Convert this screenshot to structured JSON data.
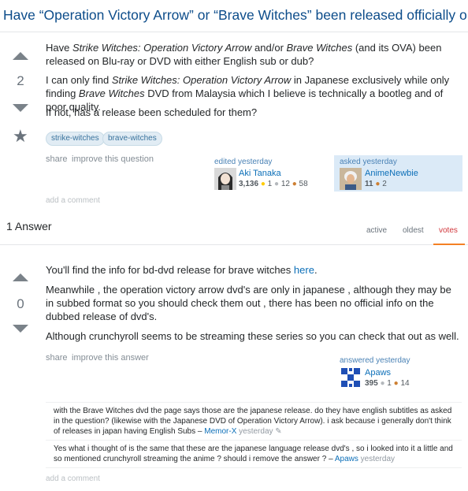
{
  "question": {
    "title": "Have “Operation Victory Arrow” or “Brave Witches” been released officially outside",
    "score": "2",
    "para1": [
      {
        "t": "Have "
      },
      {
        "t": "Strike Witches: Operation Victory Arrow",
        "em": true
      },
      {
        "t": " and/or "
      },
      {
        "t": "Brave Witches",
        "em": true
      },
      {
        "t": " (and its OVA) been released on Blu-ray or DVD with either English sub or dub?"
      }
    ],
    "para2": [
      {
        "t": "I can only find "
      },
      {
        "t": "Strike Witches: Operation Victory Arrow",
        "em": true
      },
      {
        "t": " in Japanese exclusively while only finding "
      },
      {
        "t": "Brave Witches",
        "em": true
      },
      {
        "t": " DVD from Malaysia which I believe is technically a bootleg and of poor quality."
      }
    ],
    "para3": "If not, has a release been scheduled for them?",
    "tags": [
      "strike-witches",
      "brave-witches"
    ],
    "share": "share",
    "improve": "improve this question",
    "edited": {
      "label": "edited yesterday",
      "name": "Aki Tanaka",
      "rep": "3,136",
      "gold": "1",
      "silver": "12",
      "bronze": "58"
    },
    "asked": {
      "label": "asked yesterday",
      "name": "AnimeNewbie",
      "rep": "11",
      "bronze": "2"
    },
    "add_comment": "add a comment"
  },
  "answers_header": "1 Answer",
  "tabs": [
    "active",
    "oldest",
    "votes"
  ],
  "answer": {
    "score": "0",
    "para1_pre": "You'll find the info for bd-dvd release for brave witches ",
    "para1_link": "here",
    "para1_post": ".",
    "para2": "Meanwhile , the operation victory arrow dvd's are only in japanese , although they may be in subbed format so you should check them out , there has been no official info on the dubbed release of dvd's.",
    "para3": "Although crunchyroll seems to be streaming these series so you can check that out as well.",
    "share": "share",
    "improve": "improve this answer",
    "answered": {
      "label": "answered yesterday",
      "name": "Apaws",
      "rep": "395",
      "silver": "1",
      "bronze": "14"
    },
    "comments": [
      {
        "text": "with the Brave Witches dvd the page says those are the japanese release. do they have english subtitles as asked in the question? (likewise with the Japanese DVD of Operation Victory Arrow). i ask because i generally don't think of releases in japan having English Subs – ",
        "user": "Memor-X",
        "date": "yesterday"
      },
      {
        "text": "Yes what i thought of is the same that these are the japanese language release dvd's , so i looked into it a little and so mentioned crunchyroll streaming the anime ? should i remove the answer ? – ",
        "user": "Apaws",
        "date": "yesterday"
      }
    ],
    "add_comment": "add a comment"
  }
}
